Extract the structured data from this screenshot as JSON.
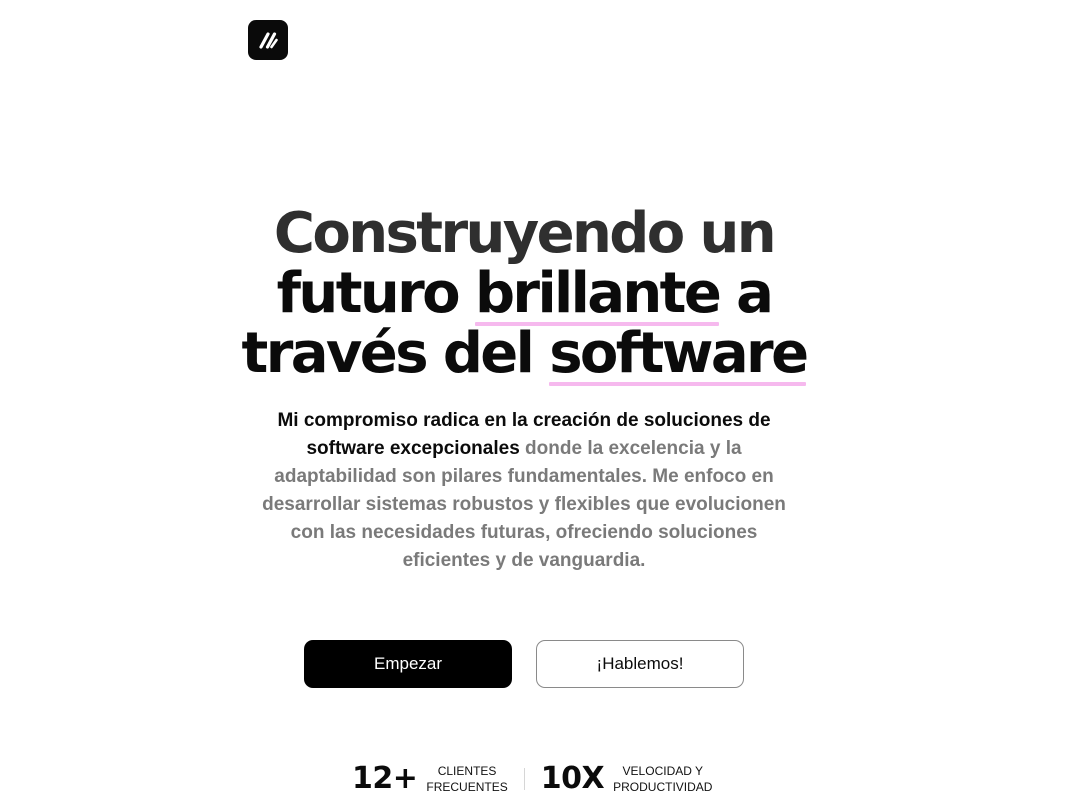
{
  "logo": {
    "icon": "double-slash-logo-icon"
  },
  "hero": {
    "headline": {
      "line1": "Construyendo un",
      "line2_a": "futuro ",
      "line2_mark": "brillante",
      "line2_b": " a",
      "line3_a": "través del ",
      "line3_mark": "software",
      "highlight_color": "#f6b9ee"
    },
    "description": {
      "strong": "Mi compromiso radica en la creación de soluciones de software excepcionales",
      "soft": " donde la excelencia y la adaptabilidad son pilares fundamentales. Me enfoco en desarrollar sistemas robustos y flexibles que evolucionen con las necesidades futuras, ofreciendo soluciones eficientes y de vanguardia."
    }
  },
  "actions": {
    "primary_label": "Empezar",
    "secondary_label": "¡Hablemos!"
  },
  "stats": [
    {
      "value": "12+",
      "label_line1": "CLIENTES",
      "label_line2": "FRECUENTES"
    },
    {
      "value": "10X",
      "label_line1": "VELOCIDAD Y",
      "label_line2": "PRODUCTIVIDAD"
    }
  ]
}
